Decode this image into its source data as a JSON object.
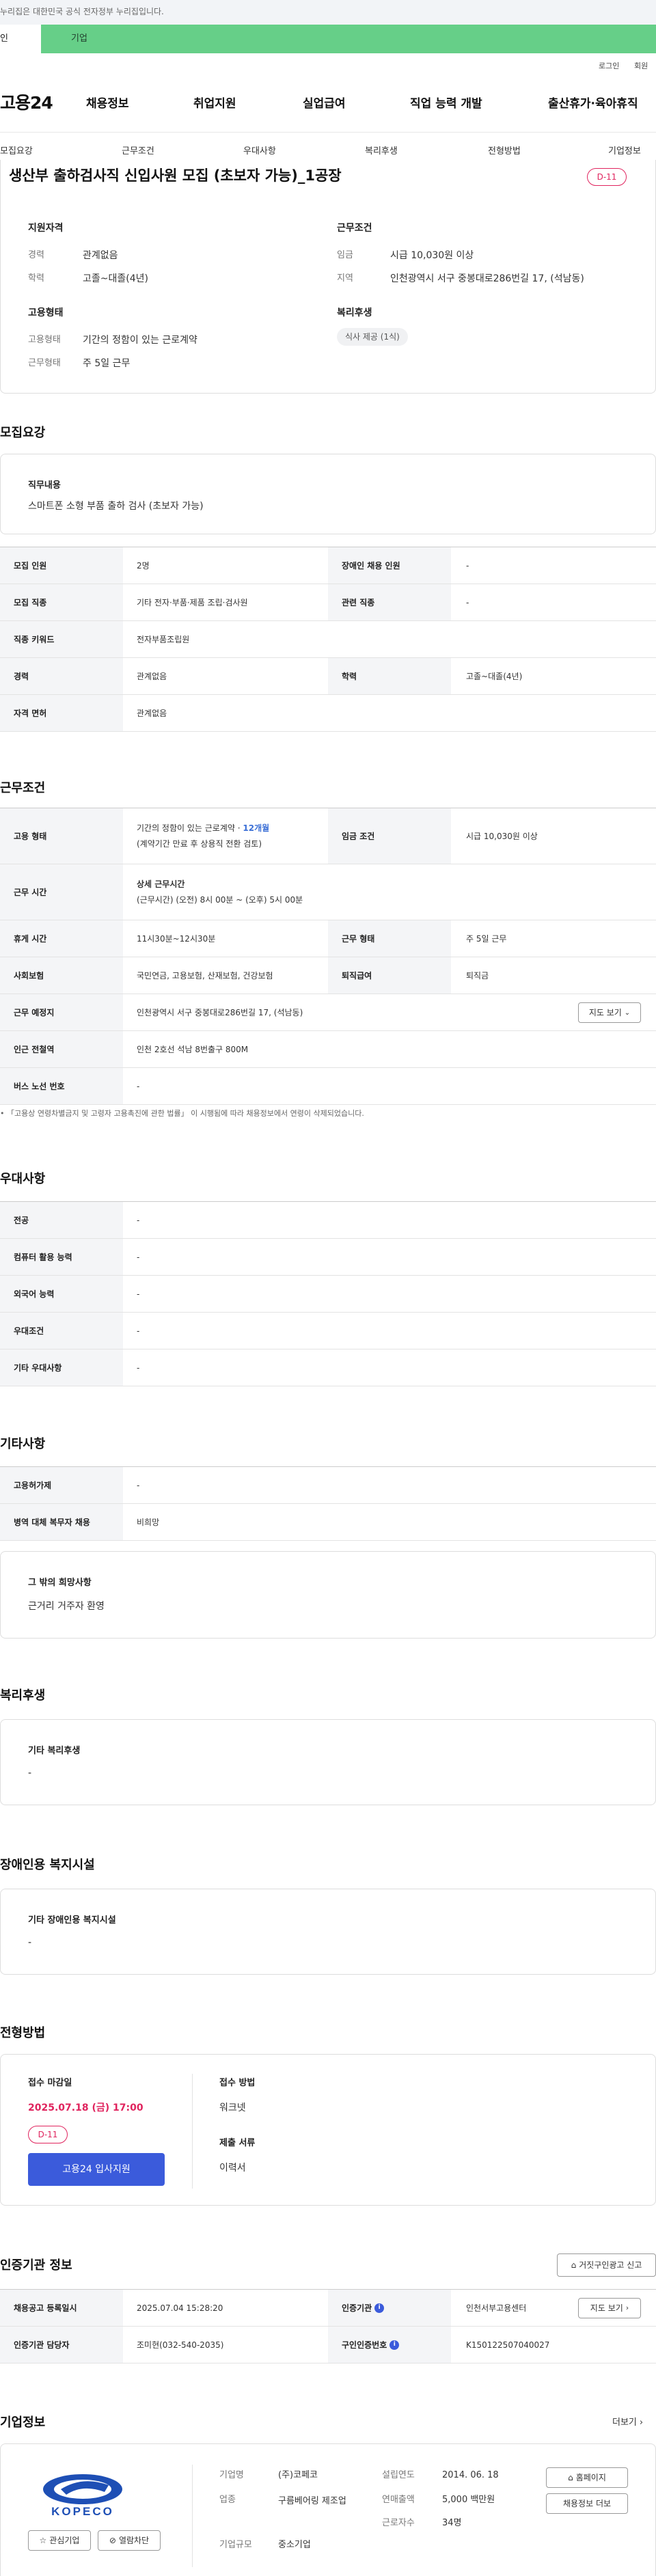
{
  "notice": "누리집은 대한민국 공식 전자정부 누리집입니다.",
  "topbar": {
    "tab_person": "인",
    "tab_corp": "기업"
  },
  "util": {
    "login": "로그인",
    "join": "회원"
  },
  "gnb": {
    "logo": "고용24",
    "items": [
      "채용정보",
      "취업지원",
      "실업급여",
      "직업 능력 개발",
      "출산휴가·육아휴직"
    ]
  },
  "subnav": [
    "모집요강",
    "근무조건",
    "우대사항",
    "복리후생",
    "전형방법",
    "기업정보"
  ],
  "job": {
    "title": "생산부 출하검사직 신입사원 모집 (초보자 가능)_1공장",
    "dday": "D-11",
    "qual_title": "지원자격",
    "career_label": "경력",
    "career": "관계없음",
    "edu_label": "학력",
    "edu": "고졸~대졸(4년)",
    "work_title": "근무조건",
    "wage_label": "임금",
    "wage": "시급 10,030원 이상",
    "region_label": "지역",
    "region": "인천광역시 서구 중봉대로286번길 17, (석남동)",
    "emp_title": "고용형태",
    "emptype_label": "고용형태",
    "emptype": "기간의 정함이 있는 근로계약",
    "workform_label": "근무형태",
    "workform": "주 5일 근무",
    "welfare_title": "복리후생",
    "welfare_chip": "식사 제공 (1식)"
  },
  "recruit": {
    "section": "모집요강",
    "duty_label": "직무내용",
    "duty": "스마트폰 소형 부품 출하 검사 (초보자 가능)",
    "rows": {
      "count_label": "모집 인원",
      "count": "2명",
      "disabled_label": "장애인 채용 인원",
      "disabled": "-",
      "job_label": "모집 직종",
      "job": "기타 전자·부품·제품 조립·검사원",
      "related_label": "관련 직종",
      "related": "-",
      "keyword_label": "직종 키워드",
      "keyword": "전자부품조립원",
      "career_label": "경력",
      "career": "관계없음",
      "edu_label": "학력",
      "edu": "고졸~대졸(4년)",
      "license_label": "자격 면허",
      "license": "관계없음"
    }
  },
  "conditions": {
    "section": "근무조건",
    "emp_label": "고용 형태",
    "emp_1": "기간의 정함이 있는 근로계약 · ",
    "emp_months": "12개월",
    "emp_2": "(계약기간 만료 후 상용직 전환 검토)",
    "wage_label": "임금 조건",
    "wage": "시급 10,030원 이상",
    "hours_label": "근무 시간",
    "hours_1": "상세 근무시간",
    "hours_2": "(근무시간) (오전) 8시 00분 ~ (오후) 5시 00분",
    "rest_label": "휴게 시간",
    "rest": "11시30분~12시30분",
    "form_label": "근무 형태",
    "form": "주 5일 근무",
    "ins_label": "사회보험",
    "ins": "국민연금, 고용보험, 산재보험, 건강보험",
    "retire_label": "퇴직급여",
    "retire": "퇴직금",
    "place_label": "근무 예정지",
    "place": "인천광역시 서구 중봉대로286번길 17, (석남동)",
    "map_btn": "지도 보기",
    "subway_label": "인근 전철역",
    "subway": "인천 2호선 석남 8번출구 800M",
    "bus_label": "버스 노선 번호",
    "bus": "-",
    "footnote": "「고용상 연령차별금지 및 고령자 고용촉진에 관한 법률」 이 시행됨에 따라 채용정보에서 연령이 삭제되었습니다."
  },
  "preference": {
    "section": "우대사항",
    "rows": [
      {
        "label": "전공",
        "value": "-"
      },
      {
        "label": "컴퓨터 활용 능력",
        "value": "-"
      },
      {
        "label": "외국어 능력",
        "value": "-"
      },
      {
        "label": "우대조건",
        "value": "-"
      },
      {
        "label": "기타 우대사항",
        "value": "-"
      }
    ]
  },
  "etc": {
    "section": "기타사항",
    "rows": [
      {
        "label": "고용허가제",
        "value": "-"
      },
      {
        "label": "병역 대체 복무자 채용",
        "value": "비희망"
      }
    ],
    "other_title": "그 밖의 희망사항",
    "other": "근거리 거주자 환영"
  },
  "welfare": {
    "section": "복리후생",
    "title": "기타 복리후생",
    "value": "-"
  },
  "facility": {
    "section": "장애인용 복지시설",
    "title": "기타 장애인용 복지시설",
    "value": "-"
  },
  "selection": {
    "section": "전형방법",
    "deadline_label": "접수 마감일",
    "deadline": "2025.07.18 (금) 17:00",
    "dday": "D-11",
    "apply_btn": "고용24 입사지원",
    "method_label": "접수 방법",
    "method": "워크넷",
    "docs_label": "제출 서류",
    "docs": "이력서"
  },
  "agency": {
    "section": "인증기관 정보",
    "report_btn": "거짓구인광고 신고",
    "reg_label": "채용공고 등록일시",
    "reg": "2025.07.04 15:28:20",
    "cert_label": "인증기관",
    "cert": "인천서부고용센터",
    "map_btn": "지도 보기",
    "manager_label": "인증기관 담당자",
    "manager": "조미현(032-540-2035)",
    "no_label": "구인인증번호",
    "no": "K150122507040027"
  },
  "company": {
    "section": "기업정보",
    "more": "더보기",
    "logo_text": "KOPECO",
    "fav_btn": "관심기업",
    "block_btn": "열람차단",
    "name_label": "기업명",
    "name": "(주)코페코",
    "industry_label": "업종",
    "industry": "구름베어링 제조업",
    "size_label": "기업규모",
    "size": "중소기업",
    "founded_label": "설립연도",
    "founded": "2014. 06. 18",
    "sales_label": "연매출액",
    "sales": "5,000 백만원",
    "emp_label": "근로자수",
    "emp": "34명",
    "home_btn": "홈페이지",
    "jobs_btn": "채용정보 더보"
  },
  "colors": {
    "green": "#66cf88",
    "accent_red": "#e0245e",
    "blue": "#3b5bdb",
    "link_blue": "#3b6fd6"
  }
}
